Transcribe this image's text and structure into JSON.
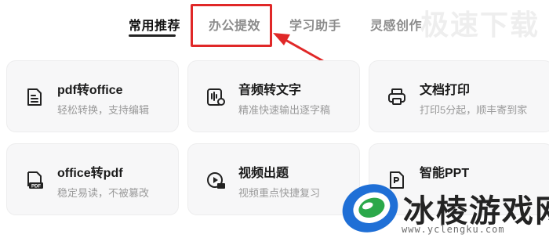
{
  "tabs": [
    {
      "label": "常用推荐",
      "active": true
    },
    {
      "label": "办公提效",
      "active": false
    },
    {
      "label": "学习助手",
      "active": false
    },
    {
      "label": "灵感创作",
      "active": false
    }
  ],
  "watermark_top": "极速下载",
  "cards": [
    {
      "title": "pdf转office",
      "desc": "轻松转换，支持编辑",
      "icon": "pdf-convert-icon"
    },
    {
      "title": "音频转文字",
      "desc": "精准快速输出逐字稿",
      "icon": "audio-to-text-icon"
    },
    {
      "title": "文档打印",
      "desc": "打印5分起，顺丰寄到家",
      "icon": "printer-icon"
    },
    {
      "title": "office转pdf",
      "desc": "稳定易读，不被篡改",
      "icon": "pdf-doc-icon"
    },
    {
      "title": "视频出题",
      "desc": "视频重点快捷复习",
      "icon": "video-quiz-icon"
    },
    {
      "title": "智能PPT",
      "desc": "",
      "icon": "ppt-icon"
    }
  ],
  "watermark": {
    "name": "冰棱游戏网",
    "url": "www.yclengku.com"
  },
  "colors": {
    "highlight": "#e02828",
    "arrow": "#e02828",
    "card_bg": "#f7f7f8"
  }
}
